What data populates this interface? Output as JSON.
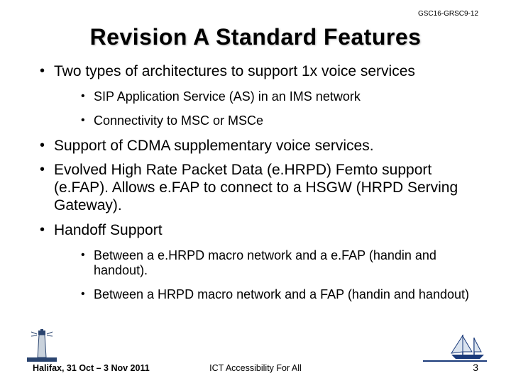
{
  "doc_number": "GSC16-GRSC9-12",
  "title": "Revision A Standard Features",
  "bullets": [
    {
      "text": "Two types of architectures to support 1x voice services",
      "sub": [
        "SIP Application Service (AS) in an IMS network",
        "Connectivity to MSC or MSCe"
      ]
    },
    {
      "text": "Support of CDMA supplementary voice services.",
      "sub": []
    },
    {
      "text": "Evolved High Rate Packet Data (e.HRPD) Femto support (e.FAP). Allows e.FAP to connect to a HSGW (HRPD Serving Gateway).",
      "sub": []
    },
    {
      "text": "Handoff Support",
      "sub": [
        "Between a e.HRPD macro network and a e.FAP (handin and handout).",
        "Between a HRPD macro network and a FAP (handin and handout)"
      ]
    }
  ],
  "footer": {
    "left": "Halifax, 31 Oct – 3 Nov 2011",
    "center": "ICT Accessibility For All",
    "page": "3"
  },
  "icons": {
    "lighthouse": "lighthouse-icon",
    "boat": "sailboat-icon"
  }
}
